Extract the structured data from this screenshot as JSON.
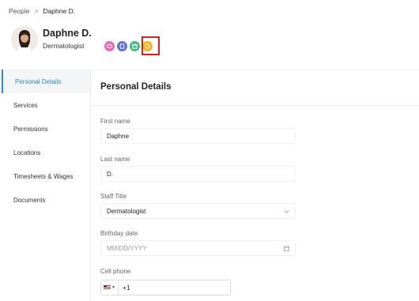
{
  "breadcrumb": {
    "parent": "People",
    "separator": ">",
    "current": "Daphne D."
  },
  "profile": {
    "name": "Daphne D.",
    "title": "Dermatologist"
  },
  "badges": [
    {
      "icon": "ipg-badge-icon",
      "color": "#e46bb7"
    },
    {
      "icon": "list-badge-icon",
      "color": "#5b73d6"
    },
    {
      "icon": "calendar-badge-icon",
      "color": "#49b887"
    },
    {
      "icon": "smile-badge-icon",
      "color": "#f2b324"
    }
  ],
  "sidebar": {
    "items": [
      {
        "label": "Personal Details",
        "active": true
      },
      {
        "label": "Services"
      },
      {
        "label": "Permissions"
      },
      {
        "label": "Locations"
      },
      {
        "label": "Timesheets & Wages"
      },
      {
        "label": "Documents"
      }
    ]
  },
  "main": {
    "title": "Personal Details",
    "fields": {
      "first_name": {
        "label": "First name",
        "value": "Daphne"
      },
      "last_name": {
        "label": "Last name",
        "value": "D."
      },
      "staff_title": {
        "label": "Staff Title",
        "value": "Dermatologist"
      },
      "birthday": {
        "label": "Birthday date",
        "placeholder": "MM/DD/YYYY"
      },
      "cell_phone": {
        "label": "Cell phone",
        "code": "+1"
      }
    }
  },
  "colors": {
    "accent": "#2c89b9",
    "highlight": "#d42020"
  }
}
